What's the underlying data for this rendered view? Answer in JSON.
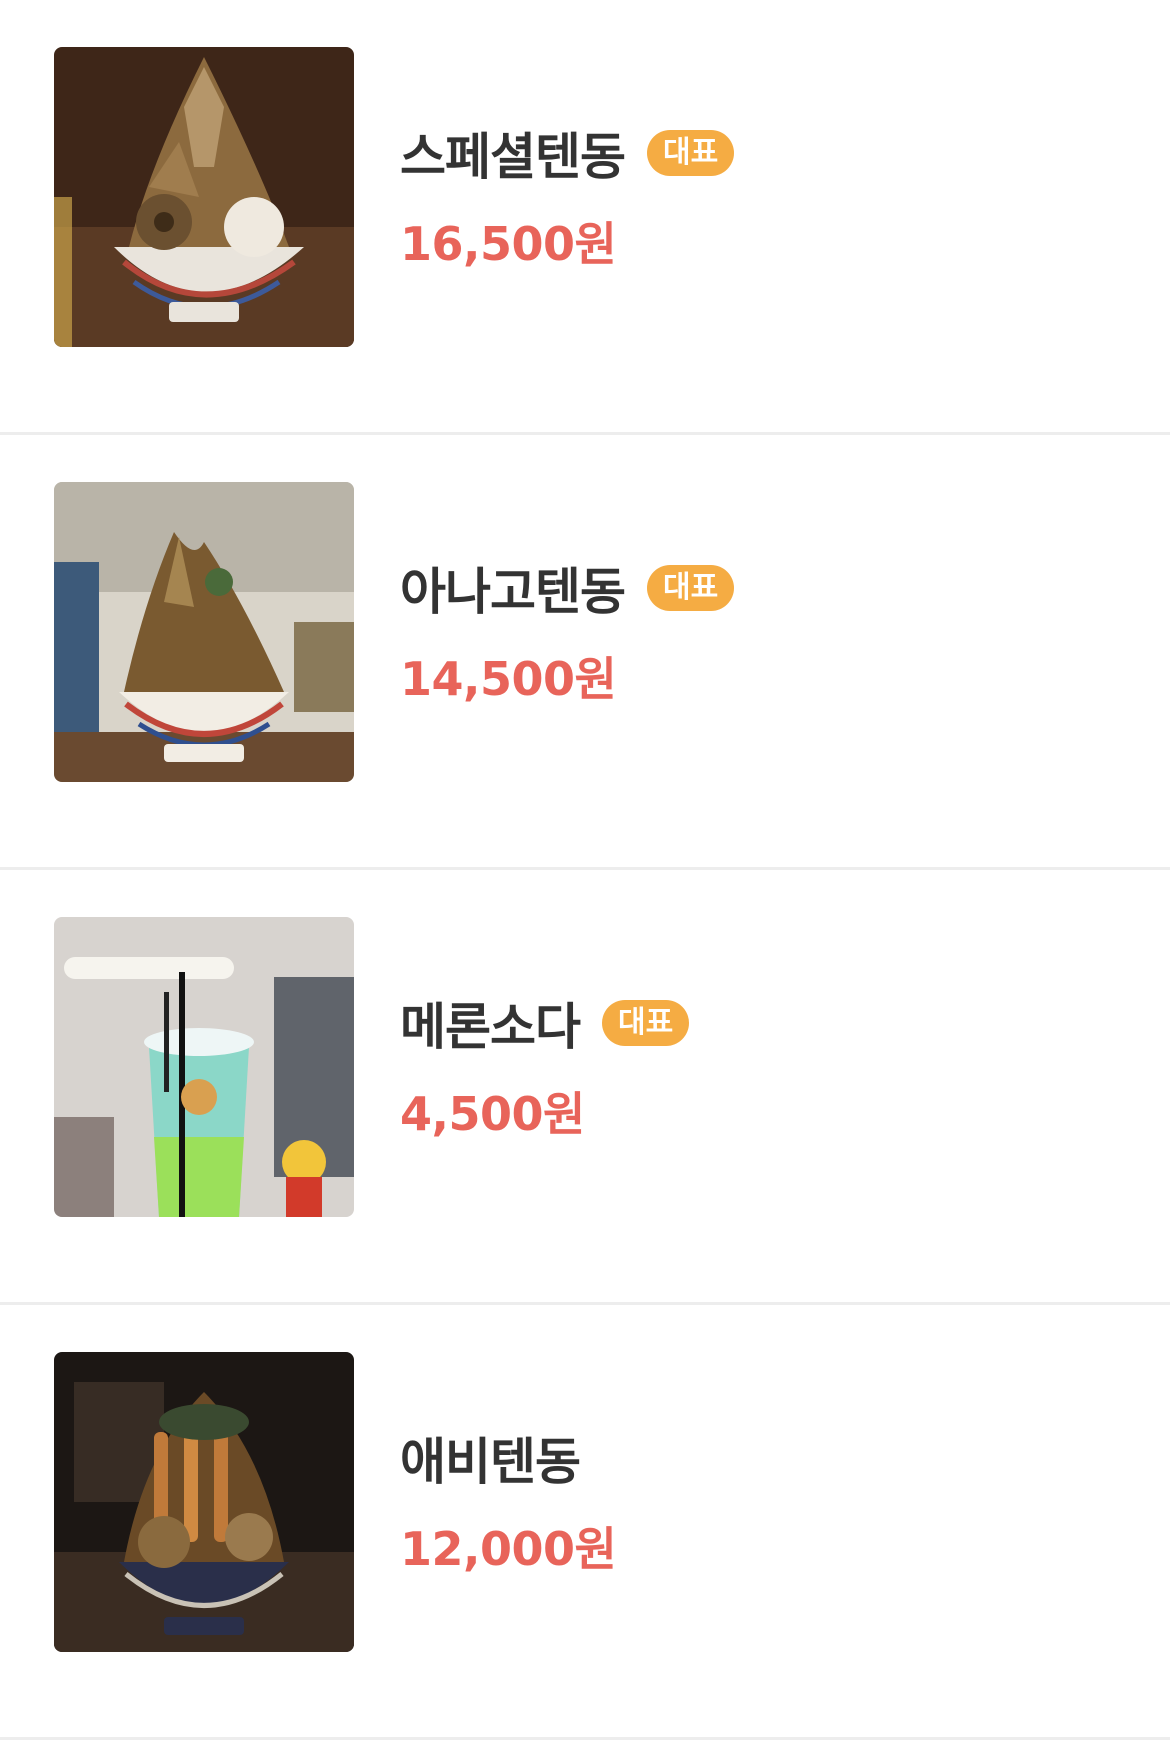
{
  "menu": {
    "items": [
      {
        "name": "스페셜텐동",
        "badge": "대표",
        "price": "16,500원",
        "photo_icon": "tendon-bowl-photo"
      },
      {
        "name": "아나고텐동",
        "badge": "대표",
        "price": "14,500원",
        "photo_icon": "tendon-bowl-photo"
      },
      {
        "name": "메론소다",
        "badge": "대표",
        "price": "4,500원",
        "photo_icon": "melon-soda-photo"
      },
      {
        "name": "애비텐동",
        "price": "12,000원",
        "photo_icon": "tendon-bowl-photo"
      }
    ]
  },
  "colors": {
    "badge_background": "#f5ac43",
    "price_text": "#e8645a",
    "name_text": "#333333",
    "divider": "#ededed"
  }
}
